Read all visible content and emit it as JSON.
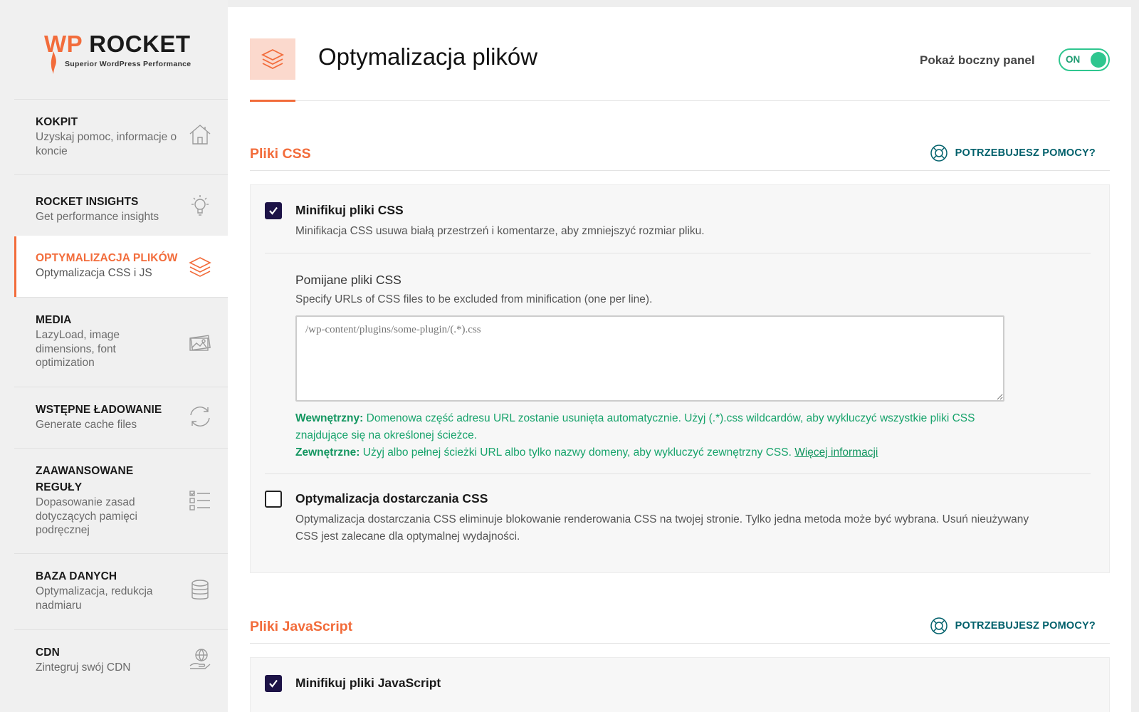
{
  "brand": {
    "wp": "WP",
    "rocket": "ROCKET",
    "tagline": "Superior WordPress Performance",
    "accent": "#f26c3b"
  },
  "sidebar": {
    "items": [
      {
        "title": "KOKPIT",
        "desc": "Uzyskaj pomoc, informacje o koncie",
        "icon": "home-icon"
      },
      {
        "title": "ROCKET INSIGHTS",
        "desc": "Get performance insights",
        "icon": "lightbulb-icon"
      },
      {
        "title": "OPTYMALIZACJA PLIKÓW",
        "desc": "Optymalizacja CSS i JS",
        "icon": "layers-icon",
        "active": true
      },
      {
        "title": "MEDIA",
        "desc": "LazyLoad, image dimensions, font optimization",
        "icon": "images-icon"
      },
      {
        "title": "WSTĘPNE ŁADOWANIE",
        "desc": "Generate cache files",
        "icon": "refresh-icon"
      },
      {
        "title": "ZAAWANSOWANE REGUŁY",
        "desc": "Dopasowanie zasad dotyczących pamięci podręcznej",
        "icon": "checklist-icon"
      },
      {
        "title": "BAZA DANYCH",
        "desc": "Optymalizacja, redukcja nadmiaru",
        "icon": "database-icon"
      },
      {
        "title": "CDN",
        "desc": "Zintegruj swój CDN",
        "icon": "globe-hand-icon"
      }
    ]
  },
  "header": {
    "title": "Optymalizacja plików",
    "toggle_label": "Pokaż boczny panel",
    "toggle_state": "ON",
    "toggle_color": "#2fc68f"
  },
  "css_section": {
    "title": "Pliki CSS",
    "help": "POTRZEBUJESZ POMOCY?",
    "minify": {
      "checked": true,
      "title": "Minifikuj pliki CSS",
      "desc": "Minifikacja CSS usuwa białą przestrzeń i komentarze, aby zmniejszyć rozmiar pliku."
    },
    "excluded": {
      "title": "Pomijane pliki CSS",
      "desc": "Specify URLs of CSS files to be excluded from minification (one per line).",
      "placeholder": "/wp-content/plugins/some-plugin/(.*).css",
      "note_internal_label": "Wewnętrzny:",
      "note_internal": " Domenowa część adresu URL zostanie usunięta automatycznie. Użyj (.*).css wildcardów, aby wykluczyć wszystkie pliki CSS znajdujące się na określonej ścieżce.",
      "note_external_label": "Zewnętrzne:",
      "note_external": " Użyj albo pełnej ścieżki URL albo tylko nazwy domeny, aby wykluczyć zewnętrzny CSS. ",
      "more_link": "Więcej informacji"
    },
    "delivery": {
      "checked": false,
      "title": "Optymalizacja dostarczania CSS",
      "desc": "Optymalizacja dostarczania CSS eliminuje blokowanie renderowania CSS na twojej stronie. Tylko jedna metoda może być wybrana. Usuń nieużywany CSS jest zalecane dla optymalnej wydajności."
    }
  },
  "js_section": {
    "title": "Pliki JavaScript",
    "help": "POTRZEBUJESZ POMOCY?",
    "minify": {
      "checked": true,
      "title": "Minifikuj pliki JavaScript"
    }
  }
}
